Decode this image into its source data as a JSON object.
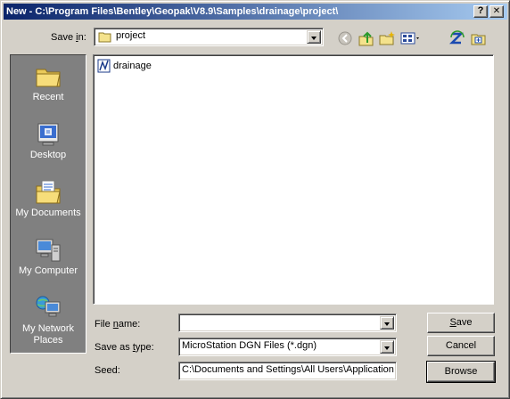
{
  "window": {
    "title": "New - C:\\Program Files\\Bentley\\Geopak\\V8.9\\Samples\\drainage\\project\\",
    "help_label": "?",
    "close_label": "✕"
  },
  "save_in": {
    "label_prefix": "Save ",
    "label_key": "i",
    "label_suffix": "n:",
    "value": "project"
  },
  "places": [
    {
      "label": "Recent"
    },
    {
      "label": "Desktop"
    },
    {
      "label": "My Documents"
    },
    {
      "label": "My Computer"
    },
    {
      "label": "My Network Places"
    }
  ],
  "files": [
    {
      "name": "drainage"
    }
  ],
  "form": {
    "file_name_label_prefix": "File ",
    "file_name_label_key": "n",
    "file_name_label_suffix": "ame:",
    "file_name_value": "",
    "save_as_type_label_prefix": "Save as ",
    "save_as_type_label_key": "t",
    "save_as_type_label_suffix": "ype:",
    "save_as_type_value": "MicroStation DGN Files (*.dgn)",
    "seed_label": "Seed:",
    "seed_value": "C:\\Documents and Settings\\All Users\\Application"
  },
  "buttons": {
    "save_key": "S",
    "save_rest": "ave",
    "cancel_label": "Cancel",
    "browse_label": "Browse"
  }
}
